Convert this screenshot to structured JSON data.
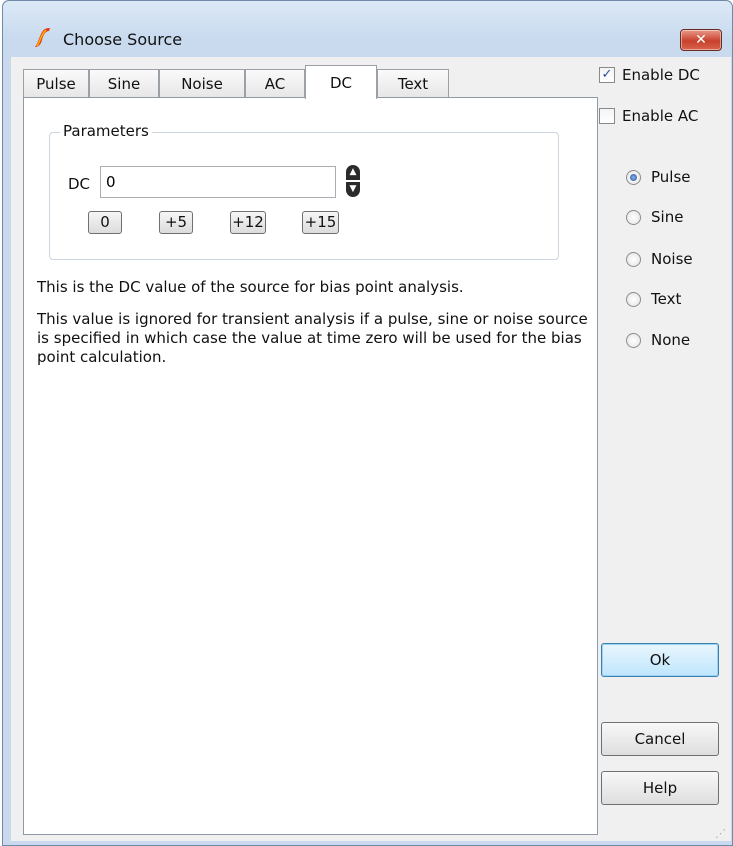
{
  "window": {
    "title": "Choose Source",
    "close_label": "✕"
  },
  "tabs": [
    {
      "label": "Pulse"
    },
    {
      "label": "Sine"
    },
    {
      "label": "Noise"
    },
    {
      "label": "AC"
    },
    {
      "label": "DC"
    },
    {
      "label": "Text"
    }
  ],
  "active_tab": "DC",
  "parameters": {
    "group_label": "Parameters",
    "dc_label": "DC",
    "dc_value": "0",
    "presets": [
      "0",
      "+5",
      "+12",
      "+15"
    ]
  },
  "descriptions": [
    "This is the DC value of the source for bias point analysis.",
    "This value is ignored for transient analysis if a pulse, sine or noise source is specified in which case the value at time zero will be used for the bias point calculation."
  ],
  "enable_dc": {
    "label": "Enable DC",
    "checked": true
  },
  "enable_ac": {
    "label": "Enable AC",
    "checked": false
  },
  "source_types": [
    {
      "label": "Pulse",
      "checked": true
    },
    {
      "label": "Sine",
      "checked": false
    },
    {
      "label": "Noise",
      "checked": false
    },
    {
      "label": "Text",
      "checked": false
    },
    {
      "label": "None",
      "checked": false
    }
  ],
  "buttons": {
    "ok": "Ok",
    "cancel": "Cancel",
    "help": "Help"
  },
  "colors": {
    "title_bar": "#c9daee",
    "close_button": "#c7412c",
    "client": "#f0f0f0"
  }
}
